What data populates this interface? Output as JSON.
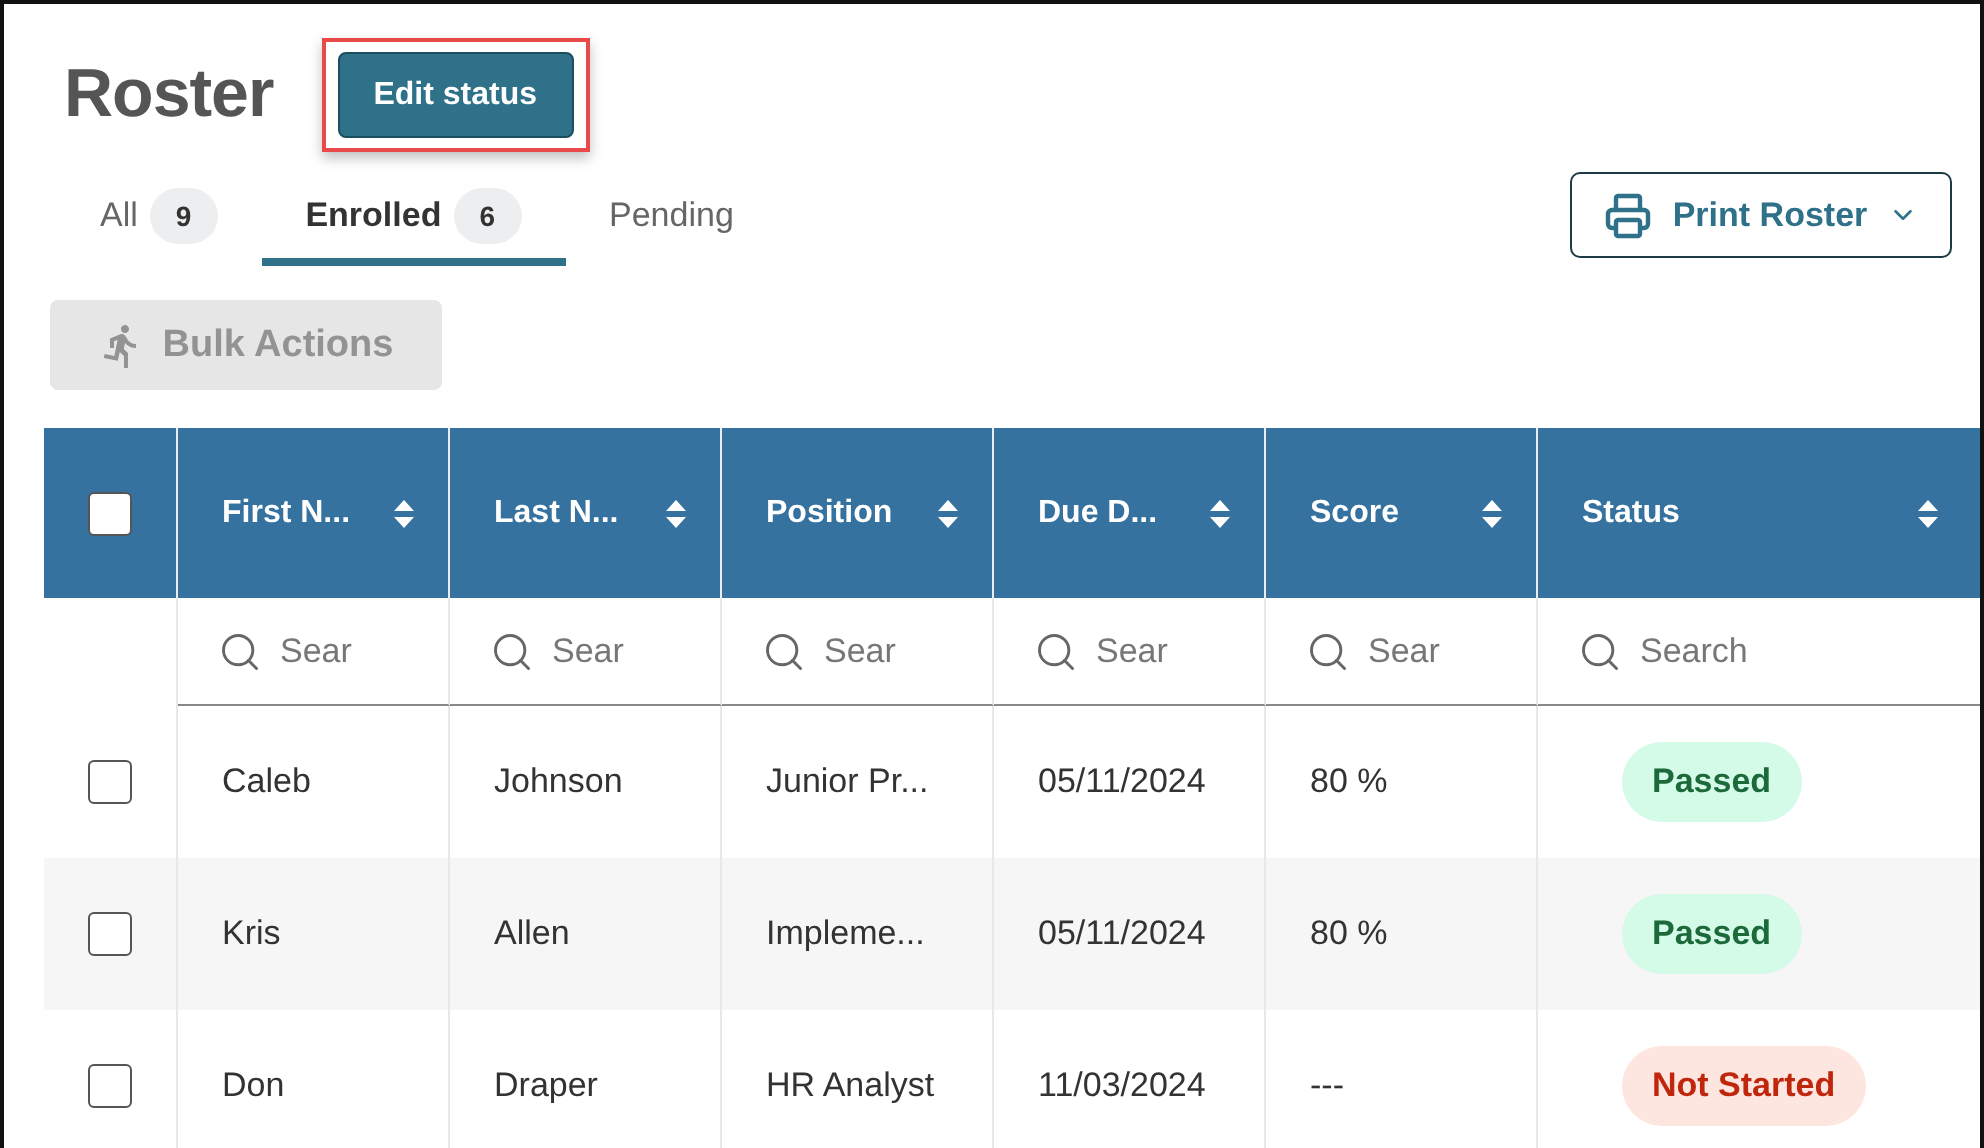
{
  "title": "Roster",
  "edit_button": {
    "label": "Edit status",
    "highlighted": true
  },
  "tabs": [
    {
      "label": "All",
      "count": "9",
      "selected": false
    },
    {
      "label": "Enrolled",
      "count": "6",
      "selected": true
    },
    {
      "label": "Pending",
      "selected": false
    }
  ],
  "print_button": {
    "label": "Print Roster"
  },
  "bulk_actions": {
    "label": "Bulk Actions",
    "disabled": true
  },
  "table": {
    "select_all": {
      "checked": false
    },
    "columns": [
      {
        "label": "First N...",
        "placeholder": "Sear"
      },
      {
        "label": "Last N...",
        "placeholder": "Sear"
      },
      {
        "label": "Position",
        "placeholder": "Sear"
      },
      {
        "label": "Due D...",
        "placeholder": "Sear"
      },
      {
        "label": "Score",
        "placeholder": "Sear"
      },
      {
        "label": "Status",
        "placeholder": "Search"
      }
    ],
    "rows": [
      {
        "checked": false,
        "cells": [
          "Caleb",
          "Johnson",
          "Junior Pr...",
          "05/11/2024",
          "80 %"
        ],
        "status": {
          "label": "Passed",
          "kind": "passed"
        }
      },
      {
        "checked": false,
        "cells": [
          "Kris",
          "Allen",
          "Impleme...",
          "05/11/2024",
          "80 %"
        ],
        "status": {
          "label": "Passed",
          "kind": "passed"
        }
      },
      {
        "checked": false,
        "cells": [
          "Don",
          "Draper",
          "HR Analyst",
          "11/03/2024",
          "---"
        ],
        "status": {
          "label": "Not Started",
          "kind": "not_started"
        }
      }
    ]
  }
}
